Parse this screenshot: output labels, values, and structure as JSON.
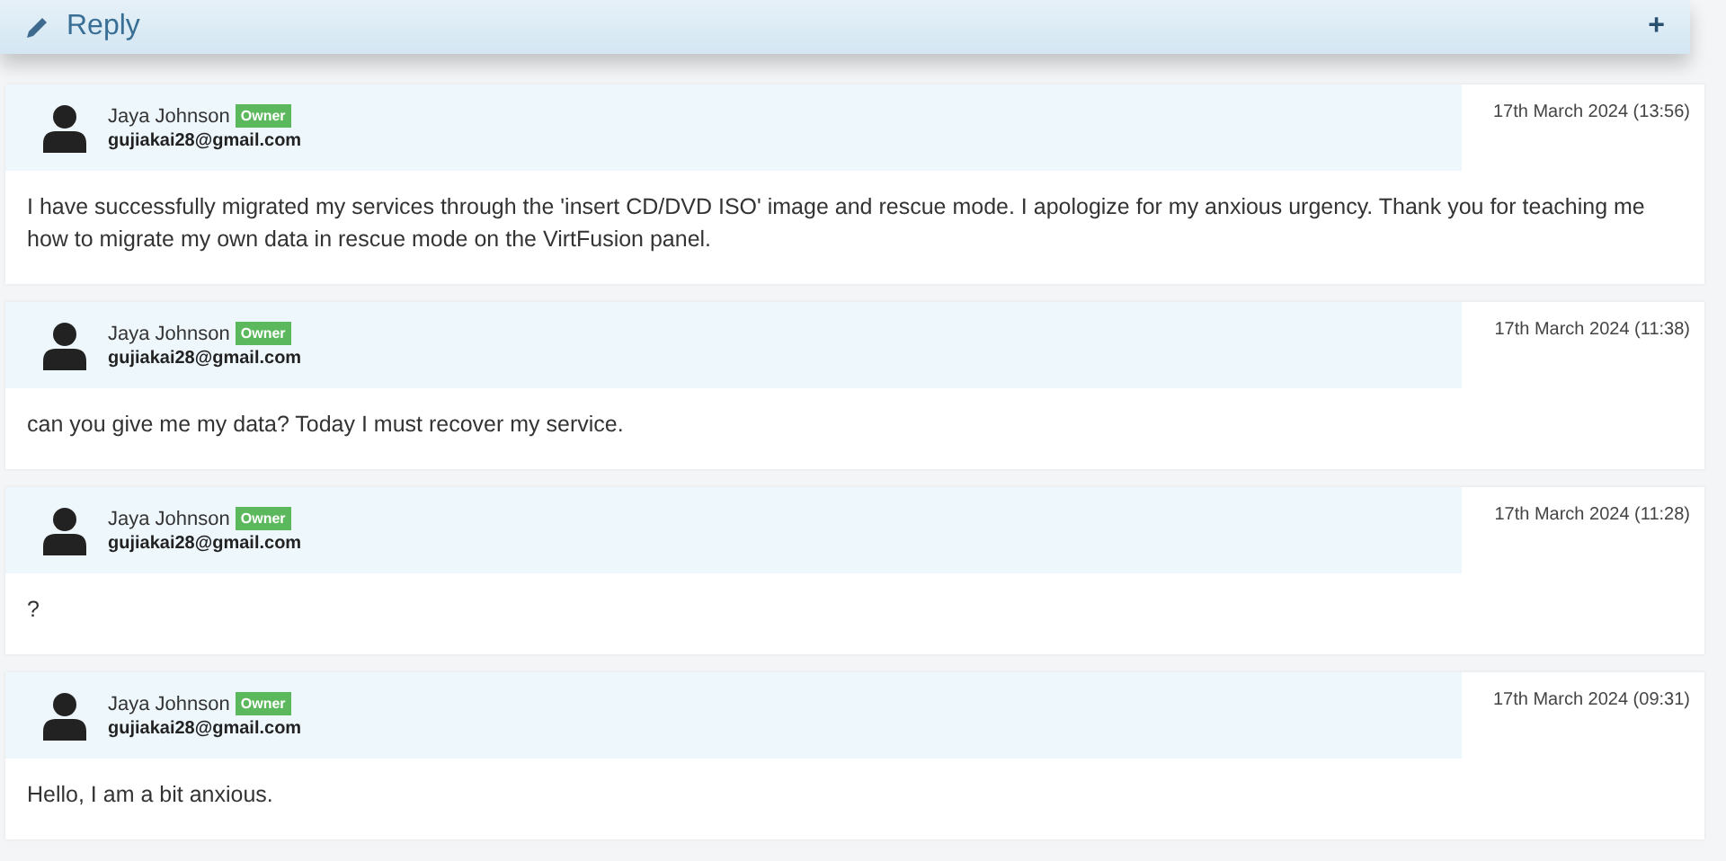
{
  "reply_bar": {
    "title": "Reply",
    "expand_symbol": "+"
  },
  "messages": [
    {
      "author": "Jaya Johnson",
      "role": "Owner",
      "email": "gujiakai28@gmail.com",
      "date": "17th March 2024 (13:56)",
      "body": "I have successfully migrated my services through the 'insert CD/DVD ISO' image and rescue mode. I apologize for my anxious urgency. Thank you for teaching me how to migrate my own data in rescue mode on the VirtFusion panel."
    },
    {
      "author": "Jaya Johnson",
      "role": "Owner",
      "email": "gujiakai28@gmail.com",
      "date": "17th March 2024 (11:38)",
      "body": "can you give me my data? Today I must recover my service."
    },
    {
      "author": "Jaya Johnson",
      "role": "Owner",
      "email": "gujiakai28@gmail.com",
      "date": "17th March 2024 (11:28)",
      "body": "?"
    },
    {
      "author": "Jaya Johnson",
      "role": "Owner",
      "email": "gujiakai28@gmail.com",
      "date": "17th March 2024 (09:31)",
      "body": "Hello, I am a bit anxious."
    }
  ]
}
